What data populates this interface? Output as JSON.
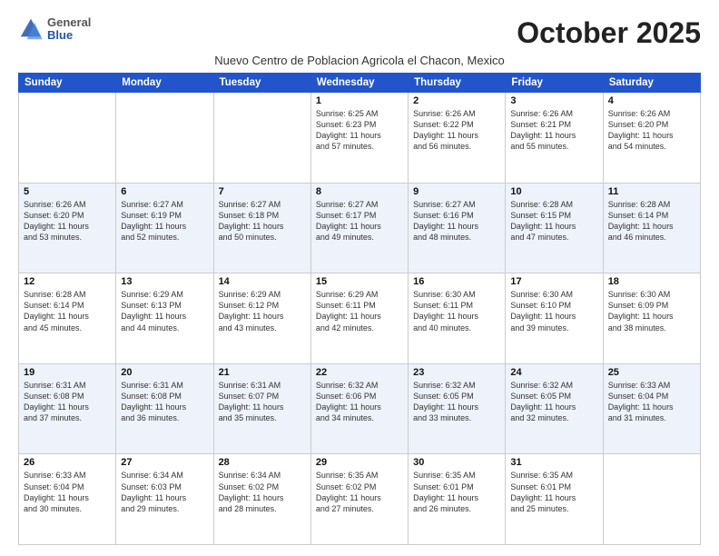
{
  "logo": {
    "general": "General",
    "blue": "Blue"
  },
  "header": {
    "month": "October 2025",
    "subtitle": "Nuevo Centro de Poblacion Agricola el Chacon, Mexico"
  },
  "days_of_week": [
    "Sunday",
    "Monday",
    "Tuesday",
    "Wednesday",
    "Thursday",
    "Friday",
    "Saturday"
  ],
  "weeks": [
    [
      {
        "day": "",
        "info": ""
      },
      {
        "day": "",
        "info": ""
      },
      {
        "day": "",
        "info": ""
      },
      {
        "day": "1",
        "info": "Sunrise: 6:25 AM\nSunset: 6:23 PM\nDaylight: 11 hours\nand 57 minutes."
      },
      {
        "day": "2",
        "info": "Sunrise: 6:26 AM\nSunset: 6:22 PM\nDaylight: 11 hours\nand 56 minutes."
      },
      {
        "day": "3",
        "info": "Sunrise: 6:26 AM\nSunset: 6:21 PM\nDaylight: 11 hours\nand 55 minutes."
      },
      {
        "day": "4",
        "info": "Sunrise: 6:26 AM\nSunset: 6:20 PM\nDaylight: 11 hours\nand 54 minutes."
      }
    ],
    [
      {
        "day": "5",
        "info": "Sunrise: 6:26 AM\nSunset: 6:20 PM\nDaylight: 11 hours\nand 53 minutes."
      },
      {
        "day": "6",
        "info": "Sunrise: 6:27 AM\nSunset: 6:19 PM\nDaylight: 11 hours\nand 52 minutes."
      },
      {
        "day": "7",
        "info": "Sunrise: 6:27 AM\nSunset: 6:18 PM\nDaylight: 11 hours\nand 50 minutes."
      },
      {
        "day": "8",
        "info": "Sunrise: 6:27 AM\nSunset: 6:17 PM\nDaylight: 11 hours\nand 49 minutes."
      },
      {
        "day": "9",
        "info": "Sunrise: 6:27 AM\nSunset: 6:16 PM\nDaylight: 11 hours\nand 48 minutes."
      },
      {
        "day": "10",
        "info": "Sunrise: 6:28 AM\nSunset: 6:15 PM\nDaylight: 11 hours\nand 47 minutes."
      },
      {
        "day": "11",
        "info": "Sunrise: 6:28 AM\nSunset: 6:14 PM\nDaylight: 11 hours\nand 46 minutes."
      }
    ],
    [
      {
        "day": "12",
        "info": "Sunrise: 6:28 AM\nSunset: 6:14 PM\nDaylight: 11 hours\nand 45 minutes."
      },
      {
        "day": "13",
        "info": "Sunrise: 6:29 AM\nSunset: 6:13 PM\nDaylight: 11 hours\nand 44 minutes."
      },
      {
        "day": "14",
        "info": "Sunrise: 6:29 AM\nSunset: 6:12 PM\nDaylight: 11 hours\nand 43 minutes."
      },
      {
        "day": "15",
        "info": "Sunrise: 6:29 AM\nSunset: 6:11 PM\nDaylight: 11 hours\nand 42 minutes."
      },
      {
        "day": "16",
        "info": "Sunrise: 6:30 AM\nSunset: 6:11 PM\nDaylight: 11 hours\nand 40 minutes."
      },
      {
        "day": "17",
        "info": "Sunrise: 6:30 AM\nSunset: 6:10 PM\nDaylight: 11 hours\nand 39 minutes."
      },
      {
        "day": "18",
        "info": "Sunrise: 6:30 AM\nSunset: 6:09 PM\nDaylight: 11 hours\nand 38 minutes."
      }
    ],
    [
      {
        "day": "19",
        "info": "Sunrise: 6:31 AM\nSunset: 6:08 PM\nDaylight: 11 hours\nand 37 minutes."
      },
      {
        "day": "20",
        "info": "Sunrise: 6:31 AM\nSunset: 6:08 PM\nDaylight: 11 hours\nand 36 minutes."
      },
      {
        "day": "21",
        "info": "Sunrise: 6:31 AM\nSunset: 6:07 PM\nDaylight: 11 hours\nand 35 minutes."
      },
      {
        "day": "22",
        "info": "Sunrise: 6:32 AM\nSunset: 6:06 PM\nDaylight: 11 hours\nand 34 minutes."
      },
      {
        "day": "23",
        "info": "Sunrise: 6:32 AM\nSunset: 6:05 PM\nDaylight: 11 hours\nand 33 minutes."
      },
      {
        "day": "24",
        "info": "Sunrise: 6:32 AM\nSunset: 6:05 PM\nDaylight: 11 hours\nand 32 minutes."
      },
      {
        "day": "25",
        "info": "Sunrise: 6:33 AM\nSunset: 6:04 PM\nDaylight: 11 hours\nand 31 minutes."
      }
    ],
    [
      {
        "day": "26",
        "info": "Sunrise: 6:33 AM\nSunset: 6:04 PM\nDaylight: 11 hours\nand 30 minutes."
      },
      {
        "day": "27",
        "info": "Sunrise: 6:34 AM\nSunset: 6:03 PM\nDaylight: 11 hours\nand 29 minutes."
      },
      {
        "day": "28",
        "info": "Sunrise: 6:34 AM\nSunset: 6:02 PM\nDaylight: 11 hours\nand 28 minutes."
      },
      {
        "day": "29",
        "info": "Sunrise: 6:35 AM\nSunset: 6:02 PM\nDaylight: 11 hours\nand 27 minutes."
      },
      {
        "day": "30",
        "info": "Sunrise: 6:35 AM\nSunset: 6:01 PM\nDaylight: 11 hours\nand 26 minutes."
      },
      {
        "day": "31",
        "info": "Sunrise: 6:35 AM\nSunset: 6:01 PM\nDaylight: 11 hours\nand 25 minutes."
      },
      {
        "day": "",
        "info": ""
      }
    ]
  ]
}
